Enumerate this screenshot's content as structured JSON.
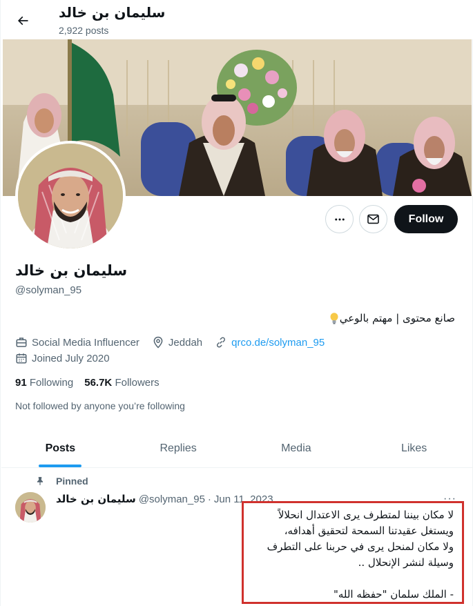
{
  "header": {
    "name": "سليمان بن خالد",
    "post_count": "2,922 posts"
  },
  "profile": {
    "display_name": "سليمان بن خالد",
    "handle": "@solyman_95",
    "bio": "صانع محتوى | مهتم بالوعي",
    "category": "Social Media Influencer",
    "location": "Jeddah",
    "website": "qrco.de/solyman_95",
    "joined": "Joined July 2020",
    "following_count": "91",
    "following_label": "Following",
    "followers_count": "56.7K",
    "followers_label": "Followers",
    "not_followed_note": "Not followed by anyone you’re following"
  },
  "actions": {
    "more_icon": "more-icon",
    "message_icon": "envelope-icon",
    "follow_label": "Follow"
  },
  "tabs": [
    {
      "label": "Posts",
      "active": true
    },
    {
      "label": "Replies",
      "active": false
    },
    {
      "label": "Media",
      "active": false
    },
    {
      "label": "Likes",
      "active": false
    }
  ],
  "tweet": {
    "pinned_label": "Pinned",
    "author": "سليمان بن خالد",
    "handle": "@solyman_95",
    "separator": "·",
    "date": "Jun 11, 2023",
    "more": "···",
    "text": "لا مكان بيننا لمتطرف يرى الاعتدال انحلالاً\nويستغل عقيدتنا السمحة لتحقيق أهدافه،\nولا مكان لمنحل يرى في حربنا على التطرف\nوسيلة لنشر الإنحلال ..\n\n- الملك سلمان \"حفظه الله\""
  },
  "colors": {
    "accent": "#1d9bf0",
    "text": "#0f1419",
    "muted": "#536471",
    "highlight_box": "#d0312d"
  }
}
